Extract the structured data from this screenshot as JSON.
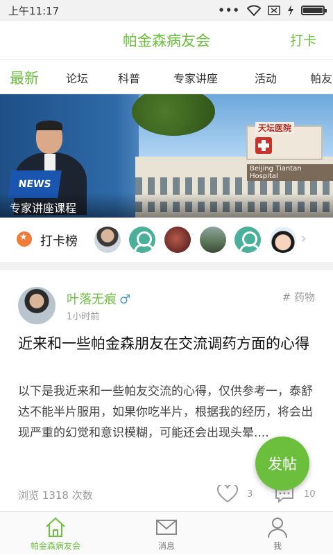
{
  "status_bar": {
    "time": "上午11:17",
    "battery_level": 1.0
  },
  "header": {
    "title": "帕金森病友会",
    "checkin_label": "打卡"
  },
  "tabs": [
    {
      "label": "最新",
      "active": true
    },
    {
      "label": "论坛",
      "active": false
    },
    {
      "label": "科普",
      "active": false
    },
    {
      "label": "专家讲座",
      "active": false
    },
    {
      "label": "活动",
      "active": false
    },
    {
      "label": "帕友",
      "active": false
    }
  ],
  "banner": {
    "caption": "专家讲座课程",
    "hospital_sign": "天坛医院",
    "hospital_label": "Beijing Tiantan Hospital",
    "news_logo": "NEWS"
  },
  "checkin_rank": {
    "label": "打卡榜",
    "avatars": [
      "user-photo",
      "default-avatar",
      "user-photo",
      "user-photo",
      "default-avatar",
      "cartoon-avatar"
    ]
  },
  "post": {
    "author": "叶落无痕",
    "gender_symbol": "♂",
    "time": "1小时前",
    "tag": "# 药物",
    "title": "近来和一些帕金森朋友在交流调药方面的心得",
    "body": "以下是我近来和一些帕友交流的心得，仅供参考一，泰舒达不能半片服用，如果你吃半片，根据我的经历，将会出现严重的幻觉和意识模糊，可能还会出现头晕....",
    "views_label": "浏览",
    "views": "1318",
    "views_unit": "次数",
    "likes": "3",
    "comments": "10"
  },
  "fab": {
    "label": "发帖"
  },
  "bottom_nav": [
    {
      "label": "帕金森病友会",
      "icon": "home-icon",
      "active": true
    },
    {
      "label": "消息",
      "icon": "mail-icon",
      "active": false
    },
    {
      "label": "我",
      "icon": "person-icon",
      "active": false
    }
  ],
  "colors": {
    "accent": "#6bbf3d",
    "male": "#4a9ad8"
  }
}
